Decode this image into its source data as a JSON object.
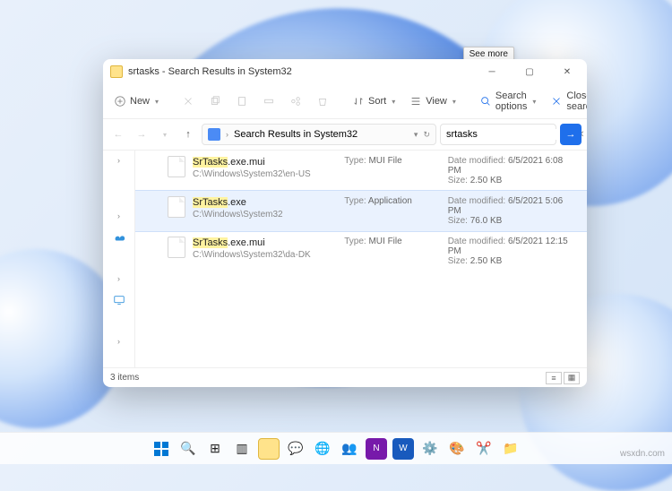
{
  "window_title": "srtasks - Search Results in System32",
  "tooltip": "See more",
  "toolbar": {
    "new": "New",
    "sort": "Sort",
    "view": "View",
    "search_options": "Search options",
    "close_search": "Close search"
  },
  "nav": {
    "breadcrumb": "Search Results in System32"
  },
  "search": {
    "value": "srtasks"
  },
  "results": [
    {
      "hl": "SrTasks",
      "rest": ".exe.mui",
      "path": "C:\\Windows\\System32\\en-US",
      "type_label": "Type:",
      "type": "MUI File",
      "date_label": "Date modified:",
      "date": "6/5/2021 6:08 PM",
      "size_label": "Size:",
      "size": "2.50 KB",
      "selected": false
    },
    {
      "hl": "SrTasks",
      "rest": ".exe",
      "path": "C:\\Windows\\System32",
      "type_label": "Type:",
      "type": "Application",
      "date_label": "Date modified:",
      "date": "6/5/2021 5:06 PM",
      "size_label": "Size:",
      "size": "76.0 KB",
      "selected": true
    },
    {
      "hl": "SrTasks",
      "rest": ".exe.mui",
      "path": "C:\\Windows\\System32\\da-DK",
      "type_label": "Type:",
      "type": "MUI File",
      "date_label": "Date modified:",
      "date": "6/5/2021 12:15 PM",
      "size_label": "Size:",
      "size": "2.50 KB",
      "selected": false
    }
  ],
  "status": {
    "count": "3 items"
  },
  "watermark": "wsxdn.com"
}
